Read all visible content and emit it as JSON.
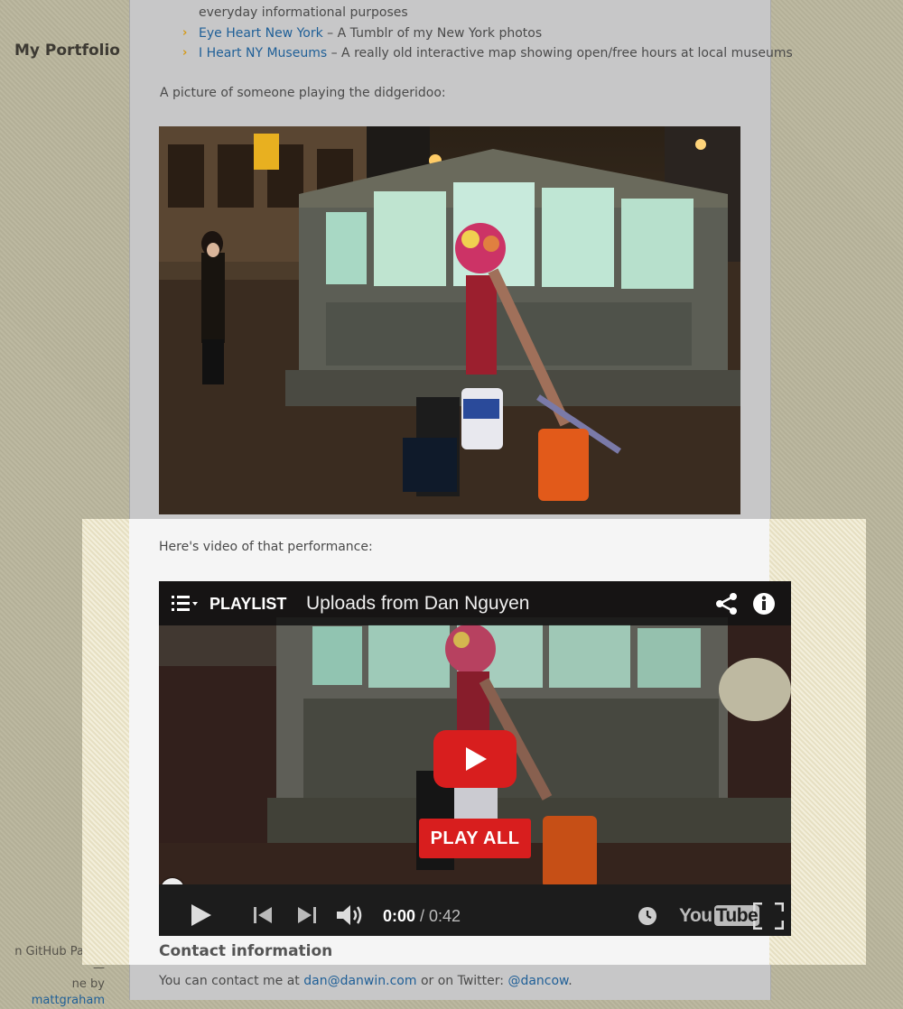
{
  "sidebar": {
    "title": "My Portfolio",
    "footer_line1": "n GitHub Pages —",
    "footer_line2_prefix": "ne by ",
    "footer_link": "mattgraham"
  },
  "links": {
    "partial_text": "everyday informational purposes",
    "items": [
      {
        "link": "Eye Heart New York",
        "desc": " – A Tumblr of my New York photos"
      },
      {
        "link": "I Heart NY Museums",
        "desc": " – A really old interactive map showing open/free hours at local museums"
      }
    ]
  },
  "photo_section": {
    "label": "A picture of someone playing the didgeridoo:"
  },
  "video_section": {
    "label": "Here's video of that performance:",
    "playlist_label": "PLAYLIST",
    "video_title": "Uploads from Dan Nguyen",
    "play_all_label": "PLAY ALL",
    "time_current": "0:00",
    "time_total": " / 0:42",
    "youtube_you": "You",
    "youtube_tube": "Tube",
    "progress_fraction": 0
  },
  "contact": {
    "heading": "Contact information",
    "prefix": "You can contact me at ",
    "email": "dan@danwin.com",
    "middle": " or on Twitter: ",
    "twitter": "@dancow",
    "suffix": "."
  },
  "colors": {
    "page_bg": "#b9b59c",
    "highlight_bg": "#ede6c8",
    "link": "#1f5f97",
    "bullet": "#d69a17",
    "youtube_red": "#d81e1e"
  }
}
